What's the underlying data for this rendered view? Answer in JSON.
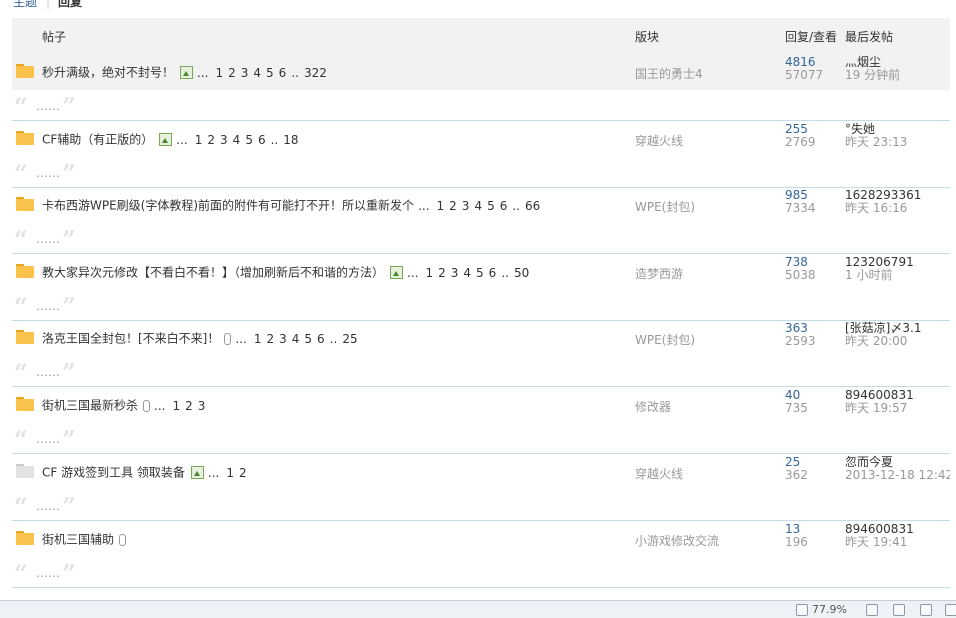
{
  "tabs": {
    "topic": "主题",
    "reply": "回复"
  },
  "header": {
    "post": "帖子",
    "board": "版块",
    "stats": "回复/查看",
    "last": "最后发帖"
  },
  "quote_text": "……",
  "quote_open": "“",
  "quote_close": "”",
  "ellipsis": "...",
  "page_dots": "..",
  "rows": [
    {
      "icon": "folder",
      "title": "秒升满级，绝对不封号！",
      "attach": "image",
      "pages": [
        "1",
        "2",
        "3",
        "4",
        "5",
        "6"
      ],
      "last_page": "322",
      "board": "国王的勇士4",
      "replies": "4816",
      "views": "57077",
      "author": "灬烟尘",
      "time": "19 分钟前",
      "highlight": true
    },
    {
      "icon": "folder",
      "title": "CF辅助（有正版的）",
      "attach": "image",
      "pages": [
        "1",
        "2",
        "3",
        "4",
        "5",
        "6"
      ],
      "last_page": "18",
      "board": "穿越火线",
      "replies": "255",
      "views": "2769",
      "author": "°失她",
      "time": "昨天 23:13",
      "highlight": false
    },
    {
      "icon": "folder",
      "title": "卡布西游WPE刷级(字体教程)前面的附件有可能打不开！所以重新发个",
      "attach": "none",
      "pages": [
        "1",
        "2",
        "3",
        "4",
        "5",
        "6"
      ],
      "last_page": "66",
      "board": "WPE(封包)",
      "replies": "985",
      "views": "7334",
      "author": "1628293361",
      "time": "昨天 16:16",
      "highlight": false
    },
    {
      "icon": "folder",
      "title": "教大家异次元修改【不看白不看！】（增加刷新后不和谐的方法）",
      "attach": "image",
      "pages": [
        "1",
        "2",
        "3",
        "4",
        "5",
        "6"
      ],
      "last_page": "50",
      "board": "造梦西游",
      "replies": "738",
      "views": "5038",
      "author": "123206791",
      "time": "1 小时前",
      "highlight": false
    },
    {
      "icon": "folder",
      "title": "洛克王国全封包！[不来白不来]！",
      "attach": "clip",
      "pages": [
        "1",
        "2",
        "3",
        "4",
        "5",
        "6"
      ],
      "last_page": "25",
      "board": "WPE(封包)",
      "replies": "363",
      "views": "2593",
      "author": "[张菇凉]〆3.1",
      "time": "昨天 20:00",
      "highlight": false
    },
    {
      "icon": "folder",
      "title": "街机三国最新秒杀",
      "attach": "clip",
      "pages": [
        "1",
        "2",
        "3"
      ],
      "last_page": "",
      "board": "修改器",
      "replies": "40",
      "views": "735",
      "author": "894600831",
      "time": "昨天 19:57",
      "highlight": false
    },
    {
      "icon": "common",
      "title": "CF 游戏签到工具 领取装备",
      "attach": "image",
      "pages": [
        "1",
        "2"
      ],
      "last_page": "",
      "board": "穿越火线",
      "replies": "25",
      "views": "362",
      "author": "忽而今夏",
      "time": "2013-12-18 12:42",
      "highlight": false
    },
    {
      "icon": "folder",
      "title": "街机三国辅助",
      "attach": "clip",
      "pages": [],
      "last_page": "",
      "board": "小游戏修改交流",
      "replies": "13",
      "views": "196",
      "author": "894600831",
      "time": "昨天 19:41",
      "highlight": false
    }
  ],
  "statusbar": {
    "zoom": "77.9%"
  }
}
